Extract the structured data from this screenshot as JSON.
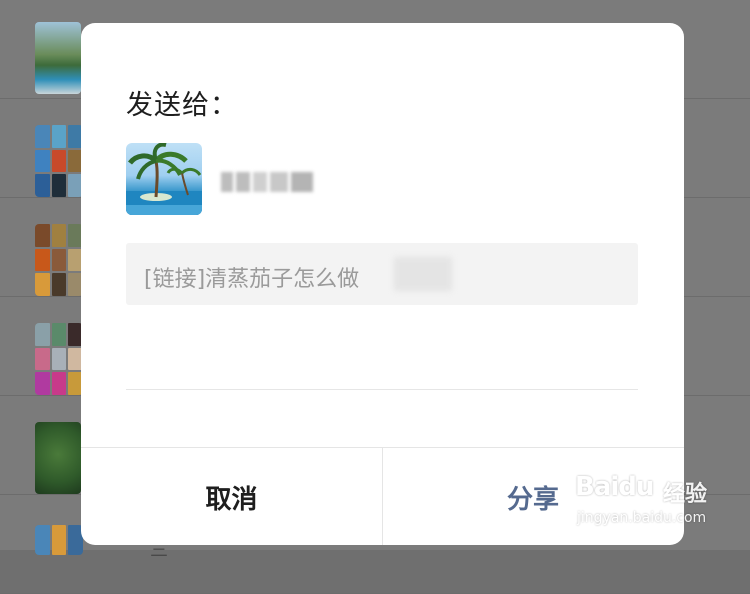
{
  "dialog": {
    "title": "发送给：",
    "message_text": "[链接]清蒸茄子怎么做",
    "cancel_label": "取消",
    "share_label": "分享"
  },
  "background": {
    "partial_text": "三"
  },
  "watermark": {
    "brand": "Baidu",
    "jingyan": "经验",
    "url": "jingyan.baidu.com"
  },
  "colors": {
    "overlay": "#7b7b7b",
    "dialog_bg": "#ffffff",
    "share_text": "#556a8f",
    "cancel_text": "#1e1e1e",
    "message_box_bg": "#f3f3f3",
    "message_text": "#9a9a9a"
  }
}
